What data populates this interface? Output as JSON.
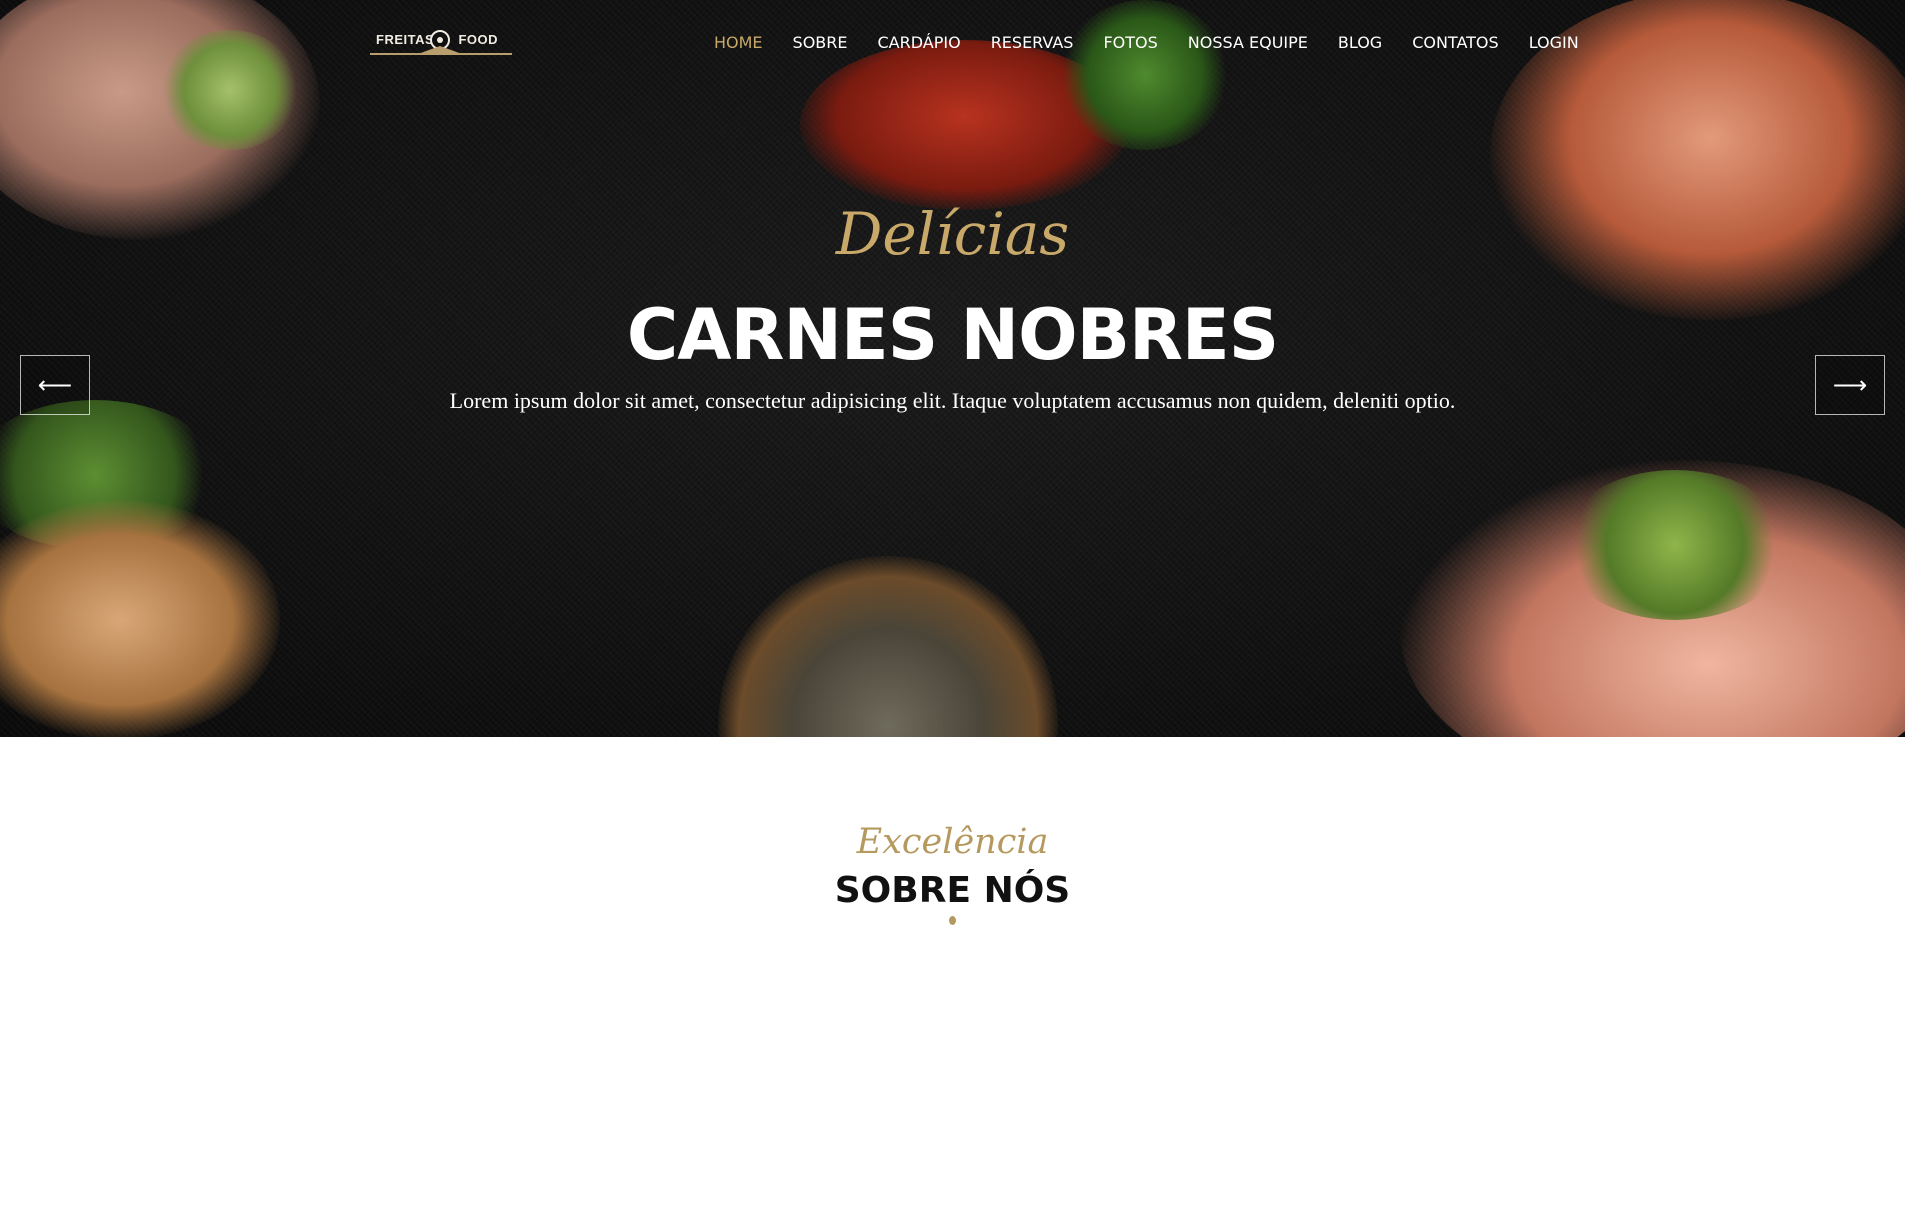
{
  "brand": {
    "left_text": "FREITAS",
    "right_text": "FOOD"
  },
  "nav": {
    "items": [
      {
        "label": "HOME",
        "active": true
      },
      {
        "label": "SOBRE",
        "active": false
      },
      {
        "label": "CARDÁPIO",
        "active": false
      },
      {
        "label": "RESERVAS",
        "active": false
      },
      {
        "label": "FOTOS",
        "active": false
      },
      {
        "label": "NOSSA EQUIPE",
        "active": false
      },
      {
        "label": "BLOG",
        "active": false
      },
      {
        "label": "CONTATOS",
        "active": false
      },
      {
        "label": "LOGIN",
        "active": false
      }
    ]
  },
  "hero": {
    "script_title": "Delícias",
    "headline": "CARNES NOBRES",
    "lede": "Lorem ipsum dolor sit amet, consectetur adipisicing elit. Itaque voluptatem accusamus non quidem, deleniti optio.",
    "prev_icon": "arrow-left-icon",
    "next_icon": "arrow-right-icon",
    "prev_glyph": "⟵",
    "next_glyph": "⟶"
  },
  "about": {
    "script_title": "Excelência",
    "title": "SOBRE NÓS"
  },
  "colors": {
    "accent_gold": "#c8a96a",
    "hero_bg": "#131313",
    "text_dark": "#111111"
  }
}
